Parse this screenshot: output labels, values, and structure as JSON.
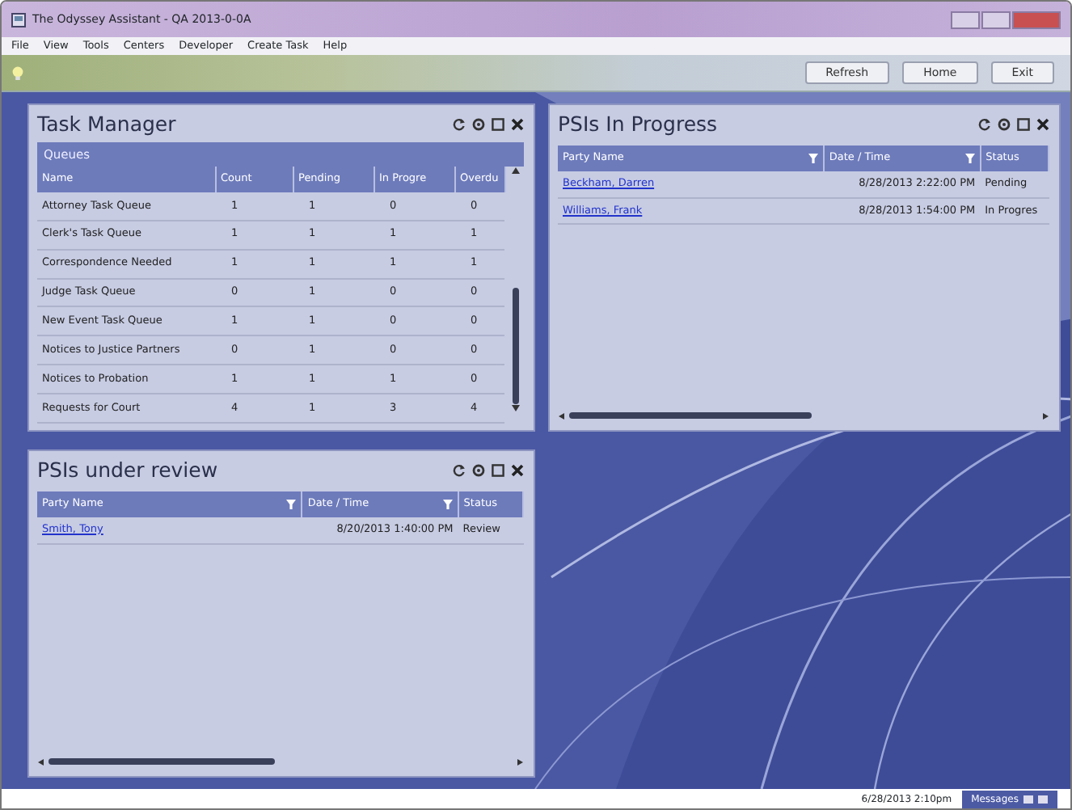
{
  "window": {
    "title": "The Odyssey Assistant - QA 2013-0-0A"
  },
  "menu": [
    "File",
    "View",
    "Tools",
    "Centers",
    "Developer",
    "Create Task",
    "Help"
  ],
  "toolbar": {
    "buttons": [
      "Refresh",
      "Home",
      "Exit"
    ]
  },
  "task_manager": {
    "title": "Task Manager",
    "group": "Queues",
    "columns": [
      "Name",
      "Count",
      "Pending",
      "In Progre",
      "Overdu"
    ],
    "rows": [
      [
        "Attorney Task Queue",
        "1",
        "1",
        "0",
        "0"
      ],
      [
        "Clerk's Task Queue",
        "1",
        "1",
        "1",
        "1"
      ],
      [
        "Correspondence Needed",
        "1",
        "1",
        "1",
        "1"
      ],
      [
        "Judge Task Queue",
        "0",
        "1",
        "0",
        "0"
      ],
      [
        "New Event Task Queue",
        "1",
        "1",
        "0",
        "0"
      ],
      [
        "Notices to Justice Partners",
        "0",
        "1",
        "0",
        "0"
      ],
      [
        "Notices to Probation",
        "1",
        "1",
        "1",
        "0"
      ],
      [
        "Requests for Court",
        "4",
        "1",
        "3",
        "4"
      ]
    ]
  },
  "psis_in_progress": {
    "title": "PSIs In Progress",
    "columns": [
      {
        "label": "Party Name",
        "filter": true
      },
      {
        "label": "Date / Time",
        "filter": true
      },
      {
        "label": "Status",
        "filter": false
      }
    ],
    "rows": [
      {
        "party_name": "Beckham, Darren",
        "date_time": "8/28/2013 2:22:00 PM",
        "status": "Pending"
      },
      {
        "party_name": "Williams, Frank",
        "date_time": "8/28/2013 1:54:00 PM",
        "status": "In Progres"
      }
    ]
  },
  "psis_under_review": {
    "title": "PSIs under review",
    "columns": [
      {
        "label": "Party Name",
        "filter": true
      },
      {
        "label": "Date / Time",
        "filter": true
      },
      {
        "label": "Status",
        "filter": false
      }
    ],
    "rows": [
      {
        "party_name": "Smith, Tony",
        "date_time": "8/20/2013 1:40:00 PM",
        "status": "Review"
      }
    ]
  },
  "status_bar": {
    "datetime": "6/28/2013 2:10pm",
    "messages_button": "Messages"
  }
}
